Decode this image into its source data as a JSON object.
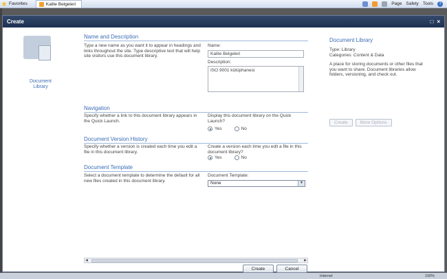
{
  "browser": {
    "favorites_label": "Favorites",
    "tab_title": "Kalite Belgeleri",
    "menu_page": "Page",
    "menu_safety": "Safety",
    "menu_tools": "Tools",
    "help": "?"
  },
  "dialog": {
    "title": "Create",
    "ctrl_restore": "□",
    "ctrl_close": "×"
  },
  "left": {
    "icon_label": "Document Library"
  },
  "name_section": {
    "title": "Name and Description",
    "description": "Type a new name as you want it to appear in headings and links throughout the site. Type descriptive text that will help site visitors use this document library.",
    "name_label": "Name:",
    "name_value": "Kalite Belgeleri",
    "desc_label": "Description:",
    "desc_value": "ISO 9001 kütüphanesi"
  },
  "nav_section": {
    "title": "Navigation",
    "description": "Specify whether a link to this document library appears in the Quick Launch.",
    "question": "Display this document library on the Quick Launch?",
    "yes": "Yes",
    "no": "No",
    "selected": "yes"
  },
  "version_section": {
    "title": "Document Version History",
    "description": "Specify whether a version is created each time you edit a file in this document library.",
    "question": "Create a version each time you edit a file in this document library?",
    "yes": "Yes",
    "no": "No",
    "selected": "yes"
  },
  "template_section": {
    "title": "Document Template",
    "description": "Select a document template to determine the default for all new files created in this document library.",
    "label": "Document Template:",
    "value": "None"
  },
  "right_panel": {
    "title": "Document Library",
    "type_line": "Type: Library",
    "categories_line": "Categories: Content & Data",
    "description": "A place for storing documents or other files that you want to share. Document libraries allow folders, versioning, and check out.",
    "create_label": "Create",
    "more_options_label": "More Options"
  },
  "footer": {
    "create_label": "Create",
    "cancel_label": "Cancel"
  },
  "status": {
    "zone": "Internet",
    "zoom": "100%"
  }
}
